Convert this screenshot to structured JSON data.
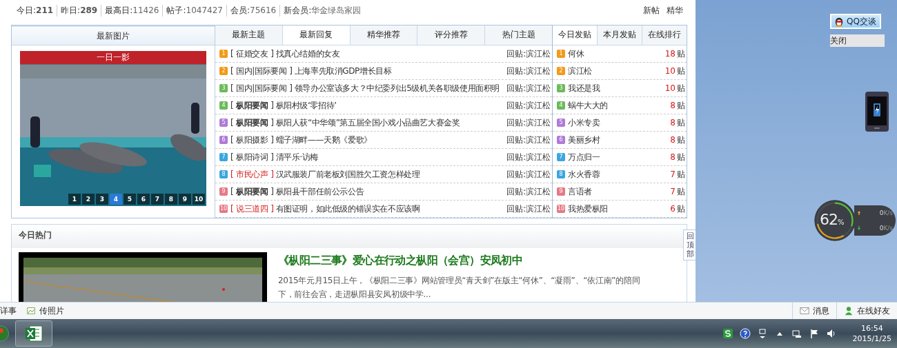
{
  "stats": [
    {
      "label": "今日:",
      "value": "211",
      "emphasis": true
    },
    {
      "label": "昨日:",
      "value": "289",
      "emphasis": true
    },
    {
      "label": "最高日:",
      "value": "11426",
      "emphasis": false
    },
    {
      "label": "帖子:",
      "value": "1047427",
      "emphasis": false
    },
    {
      "label": "会员:",
      "value": "75616",
      "emphasis": false
    },
    {
      "label": "新会员:",
      "value": "华金绿岛家园",
      "emphasis": false
    }
  ],
  "top_links": [
    "新帖",
    "精华"
  ],
  "panel": {
    "picture_header": "最新图片",
    "tabs": [
      {
        "label": "最新主题",
        "selected": false
      },
      {
        "label": "最新回复",
        "selected": true
      },
      {
        "label": "精华推荐",
        "selected": false
      },
      {
        "label": "评分推荐",
        "selected": false
      },
      {
        "label": "热门主题",
        "selected": false
      }
    ],
    "rank_tabs": [
      {
        "label": "今日发贴",
        "selected": true
      },
      {
        "label": "本月发贴",
        "selected": false
      },
      {
        "label": "在线排行",
        "selected": false
      }
    ],
    "slideshow": {
      "caption": "一日一影",
      "pages": [
        {
          "label": "1",
          "selected": false
        },
        {
          "label": "2",
          "selected": false
        },
        {
          "label": "3",
          "selected": false
        },
        {
          "label": "4",
          "selected": true
        },
        {
          "label": "5",
          "selected": false
        },
        {
          "label": "6",
          "selected": false
        },
        {
          "label": "7",
          "selected": false
        },
        {
          "label": "8",
          "selected": false
        },
        {
          "label": "9",
          "selected": false
        },
        {
          "label": "10",
          "selected": false
        }
      ]
    },
    "threads": [
      {
        "rank": "1",
        "color": "#f29a1a",
        "tag": "[ 征婚交友 ]",
        "alert": false,
        "title": "找真心结婚的女友",
        "author": "回贴:滨江松"
      },
      {
        "rank": "2",
        "color": "#f29a1a",
        "tag": "[ 国内|国际要闻 ]",
        "alert": false,
        "title": "上海率先取消GDP增长目标",
        "author": "回贴:滨江松"
      },
      {
        "rank": "3",
        "color": "#6cba5a",
        "tag": "[ 国内|国际要闻 ]",
        "alert": false,
        "title": "领导办公室该多大？中纪委列出5级机关各职级使用面积明",
        "author": "回贴:滨江松"
      },
      {
        "rank": "4",
        "color": "#6cba5a",
        "tag": "[ **枞阳要闻** ]",
        "alert": false,
        "title": "枞阳村级‘零招待’",
        "author": "回贴:滨江松"
      },
      {
        "rank": "5",
        "color": "#b07ad8",
        "tag": "[ **枞阳要闻** ]",
        "alert": false,
        "title": "枞阳人获“中华颂”第五届全国小戏小品曲艺大赛金奖",
        "author": "回贴:滨江松"
      },
      {
        "rank": "6",
        "color": "#b07ad8",
        "tag": "[ 枞阳摄影 ]",
        "alert": false,
        "title": "蠕子湖畔——天鹅《爱歌》",
        "author": "回贴:滨江松"
      },
      {
        "rank": "7",
        "color": "#3ba6e0",
        "tag": "[ 枞阳诗词 ]",
        "alert": false,
        "title": "清平乐·访梅",
        "author": "回贴:滨江松"
      },
      {
        "rank": "8",
        "color": "#3ba6e0",
        "tag": "[ 市民心声 ]",
        "alert": true,
        "title": "汉武服装厂前老板刘国胜欠工资怎样处理",
        "author": "回贴:滨江松"
      },
      {
        "rank": "9",
        "color": "#e47a86",
        "tag": "[ **枞阳要闻** ]",
        "alert": false,
        "title": "枞阳县干部任前公示公告",
        "author": "回贴:滨江松"
      },
      {
        "rank": "10",
        "color": "#e47a86",
        "tag": "[ 说三道四 ]",
        "alert": true,
        "title": "有图证明，如此低级的错误实在不应该啊",
        "author": "回贴:滨江松"
      }
    ],
    "ranking": [
      {
        "rank": "1",
        "color": "#f29a1a",
        "name": "何休",
        "count": "18",
        "unit": "贴"
      },
      {
        "rank": "2",
        "color": "#f29a1a",
        "name": "滨江松",
        "count": "10",
        "unit": "贴"
      },
      {
        "rank": "3",
        "color": "#6cba5a",
        "name": "我还是我",
        "count": "10",
        "unit": "贴"
      },
      {
        "rank": "4",
        "color": "#6cba5a",
        "name": "蜗牛大大的",
        "count": "8",
        "unit": "贴"
      },
      {
        "rank": "5",
        "color": "#b07ad8",
        "name": "小米专卖",
        "count": "8",
        "unit": "贴"
      },
      {
        "rank": "6",
        "color": "#b07ad8",
        "name": "美丽乡村",
        "count": "8",
        "unit": "贴"
      },
      {
        "rank": "7",
        "color": "#3ba6e0",
        "name": "万点归一",
        "count": "8",
        "unit": "贴"
      },
      {
        "rank": "8",
        "color": "#3ba6e0",
        "name": "水火香蓉",
        "count": "7",
        "unit": "贴"
      },
      {
        "rank": "9",
        "color": "#e47a86",
        "name": "言语者",
        "count": "7",
        "unit": "贴"
      },
      {
        "rank": "10",
        "color": "#e47a86",
        "name": "我热爱枞阳",
        "count": "6",
        "unit": "贴"
      }
    ]
  },
  "hot": {
    "header": "今日热门",
    "title": "《枞阳二三事》爱心在行动之枞阳（会宫）安凤初中",
    "summary": "2015年元月15日上午，《枞阳二三事》网站管理员“青天剑”在版主“何休”、“凝雨”、“依江南”的陪同下，前往会宫，走进枞阳县安凤初级中学..."
  },
  "back_to_top": "回顶部",
  "status_bar": {
    "left": [
      "详事",
      "传照片"
    ],
    "right": [
      "消息",
      "在线好友"
    ]
  },
  "desktop": {
    "qq_button": "QQ交谈",
    "close_button": "关闭",
    "meter": {
      "percent": "62",
      "unit": "%",
      "upload": {
        "value": "0",
        "unit": "K/s"
      },
      "download": {
        "value": "0",
        "unit": "K/s"
      }
    }
  },
  "taskbar": {
    "time": "16:54",
    "date": "2015/1/25"
  }
}
